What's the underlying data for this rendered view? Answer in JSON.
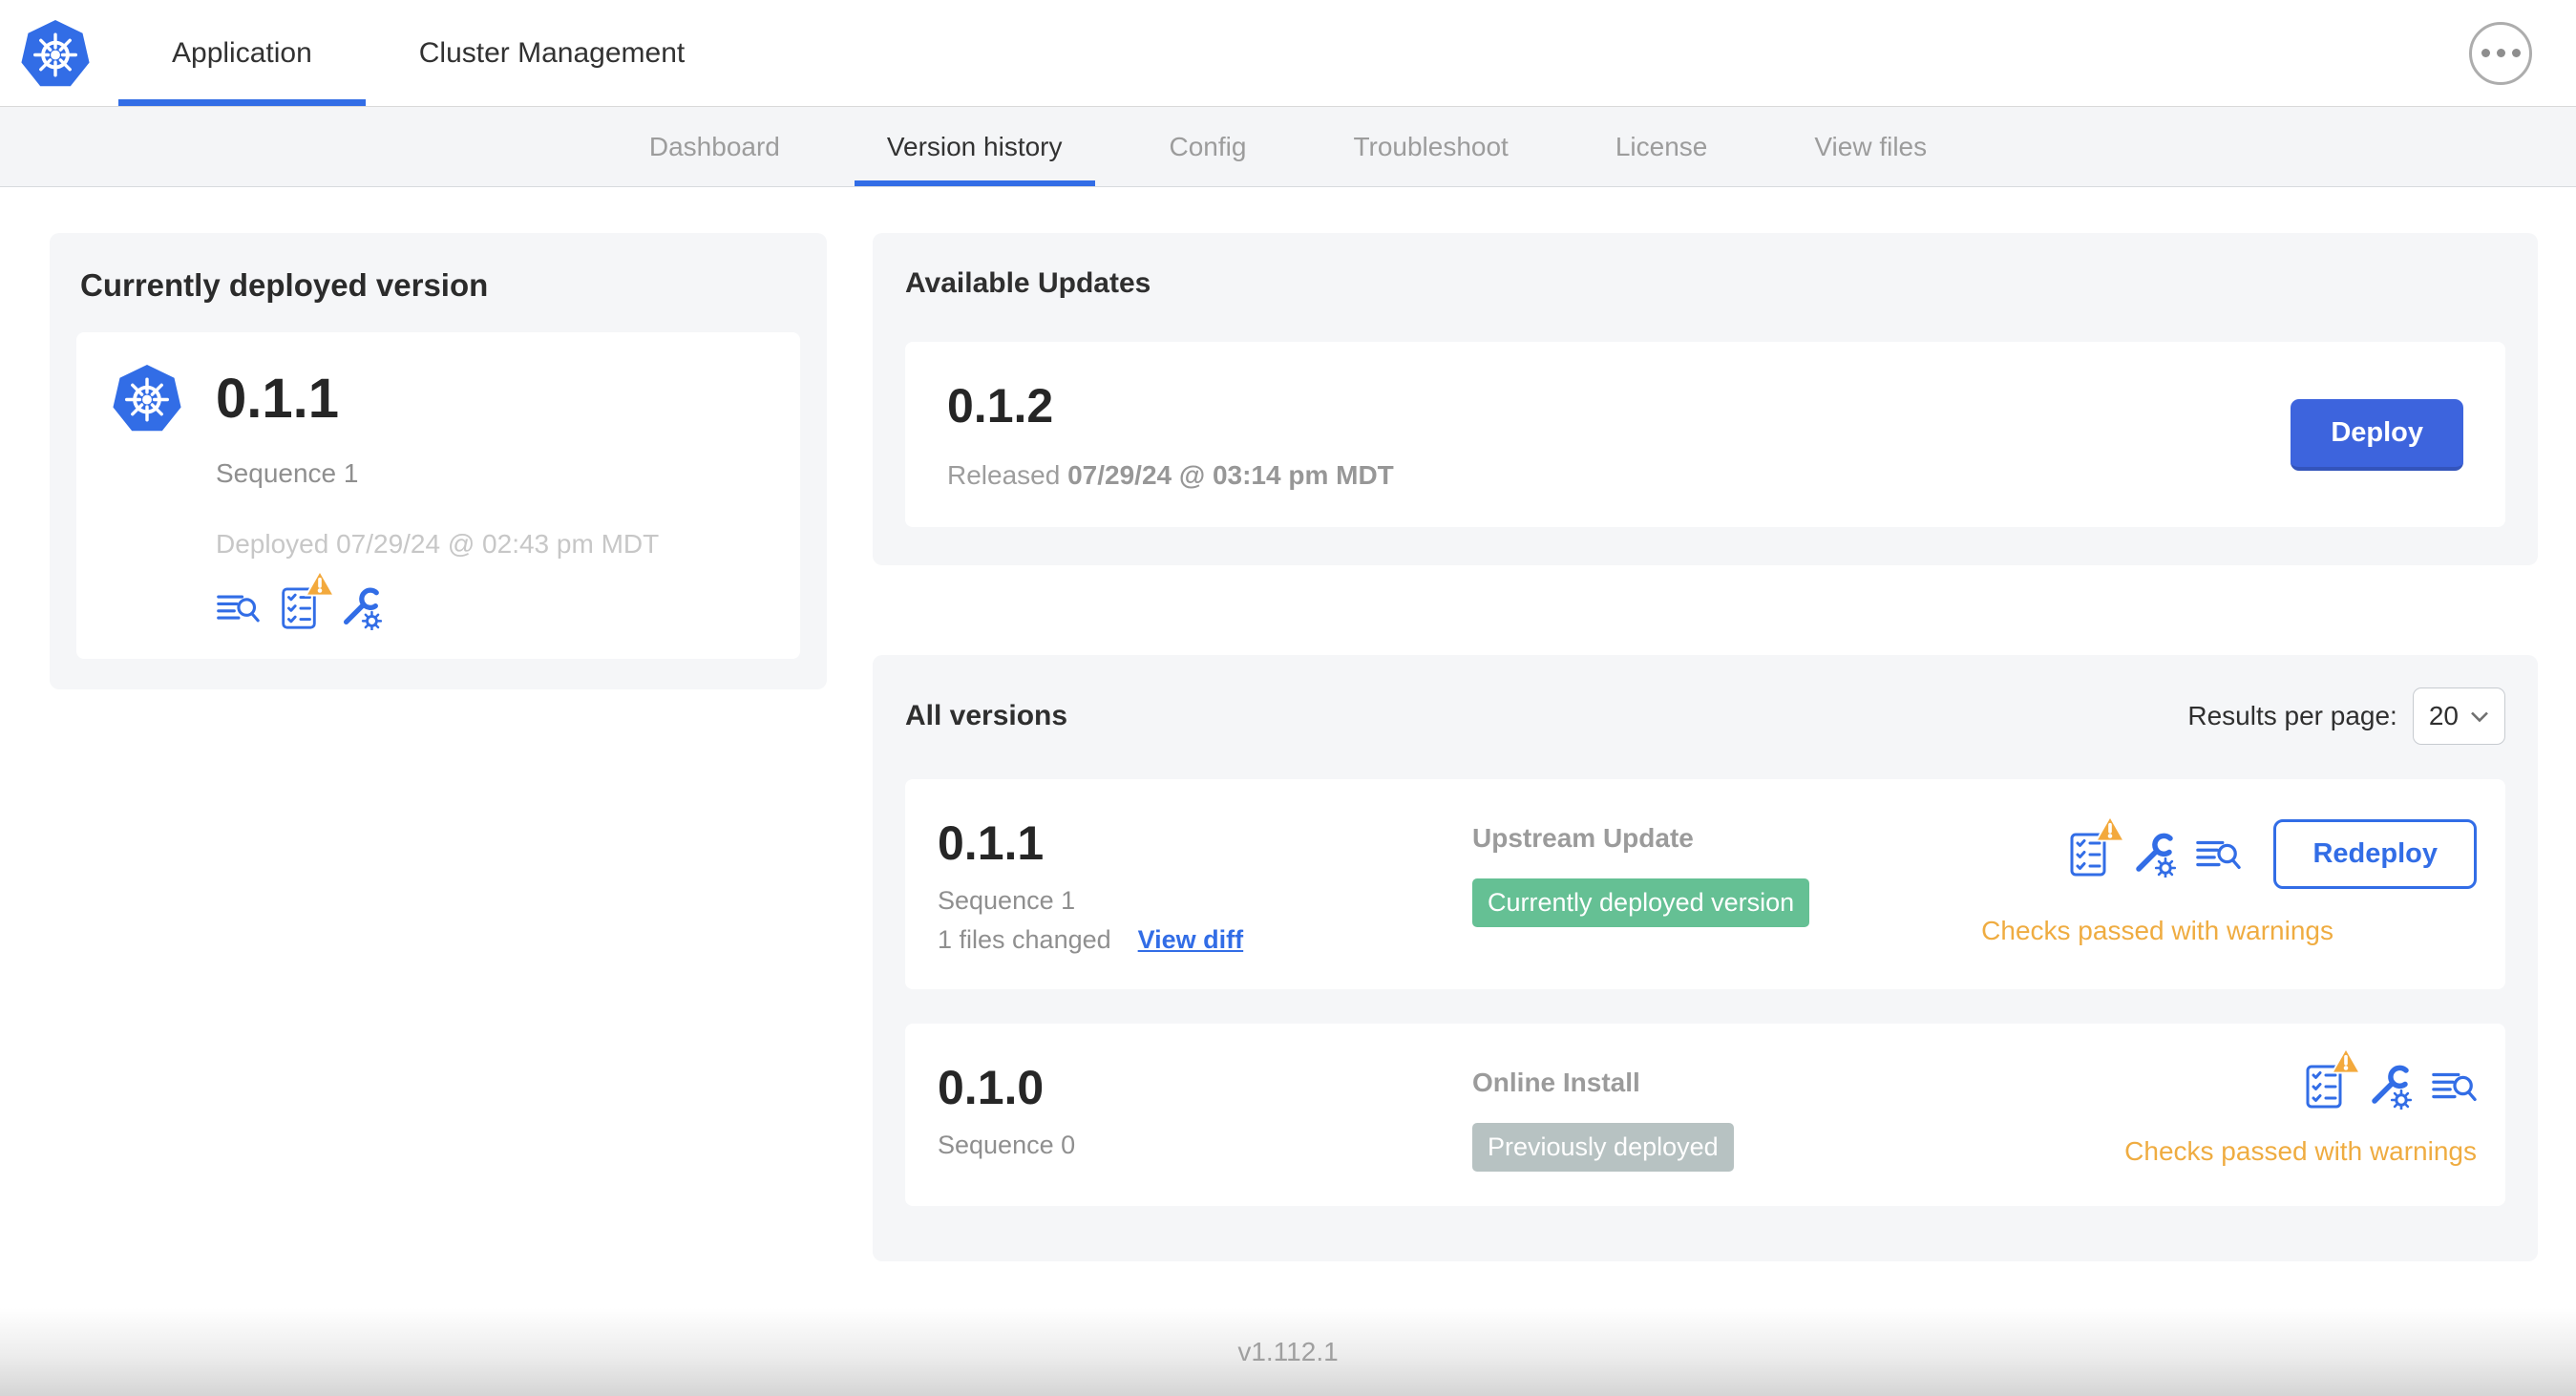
{
  "colors": {
    "primary_blue": "#326DE6",
    "deploy_button_blue": "#3D64DD",
    "warning_amber": "#EFAC41",
    "badge_green": "#65C094",
    "badge_gray": "#B7C2C2",
    "card_gray": "#f5f6f8"
  },
  "header": {
    "tabs": [
      {
        "label": "Application",
        "active": true
      },
      {
        "label": "Cluster Management",
        "active": false
      }
    ],
    "icons": [
      "kubernetes-logo",
      "ellipsis-menu-icon"
    ]
  },
  "subnav": {
    "tabs": [
      {
        "label": "Dashboard",
        "active": false
      },
      {
        "label": "Version history",
        "active": true
      },
      {
        "label": "Config",
        "active": false
      },
      {
        "label": "Troubleshoot",
        "active": false
      },
      {
        "label": "License",
        "active": false
      },
      {
        "label": "View files",
        "active": false
      }
    ]
  },
  "current_version": {
    "title": "Currently deployed version",
    "version": "0.1.1",
    "sequence": "Sequence 1",
    "deployed": "Deployed 07/29/24 @ 02:43 pm MDT",
    "icons": [
      "diff-icon",
      "preflight-checks-warning-icon",
      "config-icon"
    ]
  },
  "available_updates": {
    "title": "Available Updates",
    "update": {
      "version": "0.1.2",
      "released_label": "Released",
      "released_date": "07/29/24 @ 03:14 pm MDT",
      "deploy_label": "Deploy"
    }
  },
  "all_versions": {
    "title": "All versions",
    "results_per_page_label": "Results per page:",
    "results_per_page_value": "20",
    "rows": [
      {
        "version": "0.1.1",
        "sequence": "Sequence 1",
        "files_changed": "1 files changed",
        "view_diff_label": "View diff",
        "source": "Upstream Update",
        "badge": "Currently deployed version",
        "badge_color": "#65C094",
        "checks": "Checks passed with warnings",
        "action_label": "Redeploy",
        "icons": [
          "preflight-checks-warning-icon",
          "config-icon",
          "diff-icon"
        ]
      },
      {
        "version": "0.1.0",
        "sequence": "Sequence 0",
        "source": "Online Install",
        "badge": "Previously deployed",
        "badge_color": "#B7C2C2",
        "checks": "Checks passed with warnings",
        "icons": [
          "preflight-checks-warning-icon",
          "config-icon",
          "diff-icon"
        ]
      }
    ]
  },
  "footer": {
    "app_version": "v1.112.1"
  }
}
